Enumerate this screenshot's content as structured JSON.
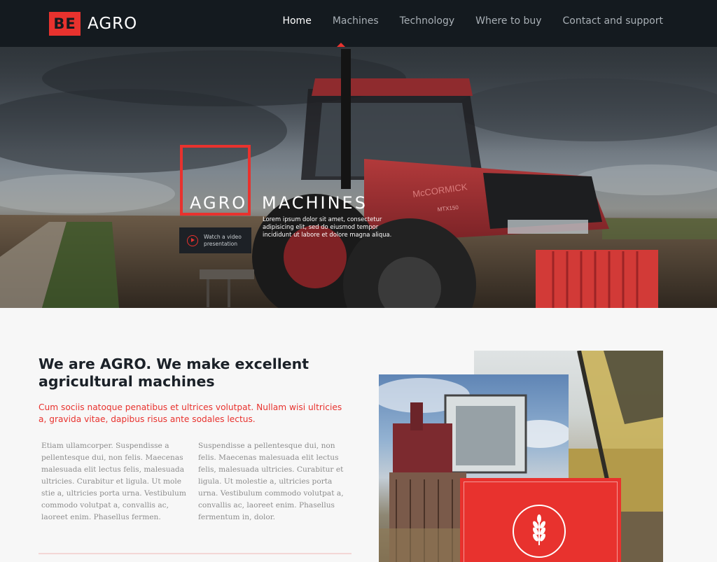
{
  "brand": {
    "badge": "BE",
    "name": "AGRO",
    "accent": "#e8322e"
  },
  "nav": {
    "items": [
      {
        "label": "Home",
        "active": true
      },
      {
        "label": "Machines",
        "active": false
      },
      {
        "label": "Technology",
        "active": false
      },
      {
        "label": "Where to buy",
        "active": false
      },
      {
        "label": "Contact and support",
        "active": false
      }
    ]
  },
  "hero": {
    "title_part1": "AGRO",
    "title_part2": "MACHINES",
    "description": "Lorem ipsum dolor sit amet, consectetur adipisicing elit, sed do eiusmod tempor incididunt ut labore et dolore magna aliqua.",
    "video_button": "Watch a video presentation",
    "tractor_brand": "McCORMICK",
    "tractor_model": "MTX150"
  },
  "about": {
    "heading": "We are AGRO. We make excellent agricultural machines",
    "lead": "Cum sociis natoque penatibus et ultrices volutpat. Nullam wisi ultricies a, gravida vitae, dapibus risus ante sodales lectus.",
    "col1": "Etiam ullamcorper. Suspendisse a pellentesque dui, non felis. Maecenas malesuada elit lectus felis, malesuada ultricies. Curabitur et ligula. Ut mole stie a, ultricies porta urna. Vestibulum commodo volutpat a, convallis ac, laoreet enim. Phasellus fermen.",
    "col2": "Suspendisse a pellentesque dui, non felis. Maecenas malesuada elit lectus felis, malesuada ultricies. Curabitur et ligula. Ut molestie a, ultricies porta urna. Vestibulum commodo volutpat a, convallis ac, laoreet enim. Phasellus fermentum in, dolor."
  },
  "icons": {
    "play": "play-circle-icon",
    "wheat": "wheat-icon"
  }
}
